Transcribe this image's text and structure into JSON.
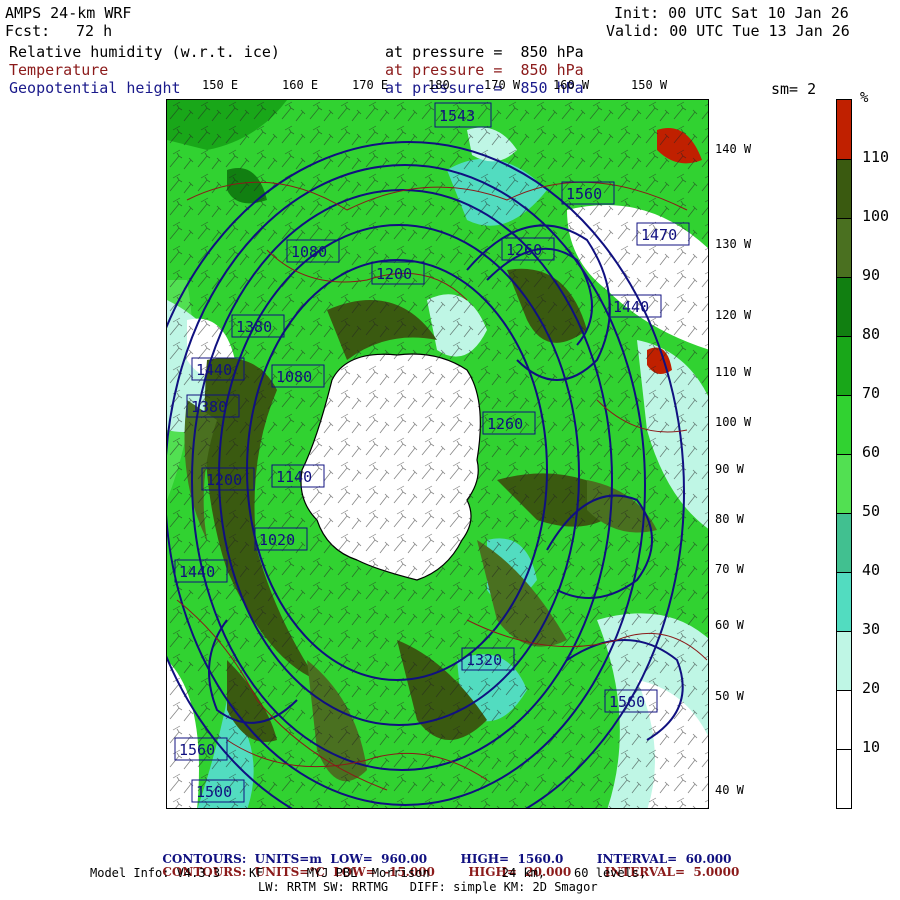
{
  "header": {
    "model": "AMPS 24-km WRF",
    "fcst_label": "Fcst:",
    "fcst_value": "72 h",
    "init": "Init: 00 UTC Sat 10 Jan 26",
    "valid": "Valid: 00 UTC Tue 13 Jan 26"
  },
  "fields": [
    {
      "name": "Relative humidity (w.r.t. ice)",
      "pressure": "at pressure =  850 hPa",
      "color": "#000000"
    },
    {
      "name": "Temperature",
      "pressure": "at pressure =  850 hPa",
      "color": "#8b1a1a"
    },
    {
      "name": "Geopotential height",
      "pressure": "at pressure =  850 hPa",
      "color": "#1a1a8b"
    }
  ],
  "smoothing": "sm= 2",
  "lon_labels": [
    "150 E",
    "160 E",
    "170 E",
    "180",
    "170 W",
    "160 W",
    "150 W"
  ],
  "lat_labels": [
    "140 W",
    "130 W",
    "120 W",
    "110 W",
    "100 W",
    "90 W",
    "80 W",
    "70 W",
    "60 W",
    "50 W",
    "40 W"
  ],
  "colorbar": {
    "unit": "%",
    "labels": [
      "110",
      "100",
      "90",
      "80",
      "70",
      "60",
      "50",
      "40",
      "30",
      "20",
      "10"
    ],
    "colors": [
      "#c02000",
      "#3a5a10",
      "#4a7020",
      "#117f11",
      "#19a719",
      "#31d231",
      "#52e052",
      "#41c090",
      "#52dcc0",
      "#bff6e5",
      "#ffffff",
      "#ffffff"
    ]
  },
  "height_labels": [
    "1543",
    "1560",
    "1560",
    "1080",
    "1440",
    "1470",
    "1200",
    "1260",
    "1380",
    "1380",
    "1440",
    "1080",
    "1140",
    "1200",
    "1260",
    "1020",
    "1320",
    "1440",
    "1560",
    "1500"
  ],
  "footer": {
    "line1": {
      "label": "CONTOURS:",
      "units": "UNITS=m",
      "low_label": "LOW=",
      "low": "960.00",
      "high_label": "HIGH=",
      "high": "1560.0",
      "interval_label": "INTERVAL=",
      "interval": "60.000"
    },
    "line2": {
      "label": "CONTOURS:",
      "units": "UNITS=°C",
      "low_label": "LOW=",
      "low": "-15.000",
      "high_label": "HIGH=",
      "high": "20.000",
      "interval_label": "INTERVAL=",
      "interval": "5.0000"
    },
    "model_info": "Model Info: V4.3.3    KF      MYJ PBL  Morrison          24 km,    60 levels,",
    "model_info2": "LW: RRTM SW: RRTMG   DIFF: simple KM: 2D Smagor"
  }
}
